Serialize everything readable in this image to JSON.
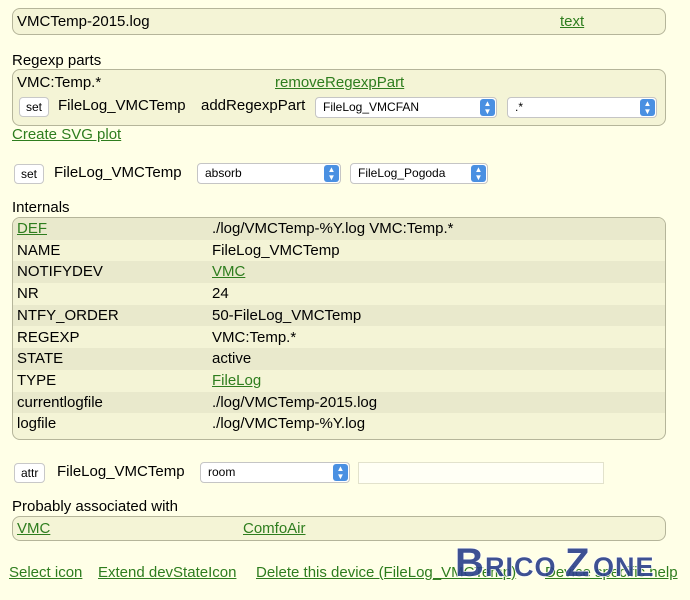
{
  "header": {
    "device_name": "VMCTemp-2015.log",
    "text_link": "text"
  },
  "regexp": {
    "section_title": "Regexp parts",
    "current_part": "VMC:Temp.*",
    "remove_link": "removeRegexpPart",
    "set_label": "set",
    "device": "FileLog_VMCTemp",
    "add_label": "addRegexpPart",
    "device_select": "FileLog_VMCFAN",
    "pattern_select": ".*"
  },
  "svg_link": "Create SVG plot",
  "setline": {
    "set_label": "set",
    "device": "FileLog_VMCTemp",
    "command_select": "absorb",
    "target_select": "FileLog_Pogoda"
  },
  "internals": {
    "section_title": "Internals",
    "rows": [
      {
        "key": "DEF",
        "value": "./log/VMCTemp-%Y.log VMC:Temp.*"
      },
      {
        "key": "NAME",
        "value": "FileLog_VMCTemp"
      },
      {
        "key": "NOTIFYDEV",
        "value": "VMC"
      },
      {
        "key": "NR",
        "value": "24"
      },
      {
        "key": "NTFY_ORDER",
        "value": "50-FileLog_VMCTemp"
      },
      {
        "key": "REGEXP",
        "value": "VMC:Temp.*"
      },
      {
        "key": "STATE",
        "value": "active"
      },
      {
        "key": "TYPE",
        "value": "FileLog"
      },
      {
        "key": "currentlogfile",
        "value": "./log/VMCTemp-2015.log"
      },
      {
        "key": "logfile",
        "value": "./log/VMCTemp-%Y.log"
      }
    ]
  },
  "attr": {
    "attr_label": "attr",
    "device": "FileLog_VMCTemp",
    "attr_select": "room",
    "value_input": ""
  },
  "associated": {
    "section_title": "Probably associated with",
    "items": [
      "VMC",
      "ComfoAir"
    ]
  },
  "footer": {
    "select_icon": "Select icon",
    "extend": "Extend devStateIcon",
    "delete": "Delete this device (FileLog_VMCTemp)",
    "help": "Device specific help"
  },
  "watermark": "BricoZone"
}
